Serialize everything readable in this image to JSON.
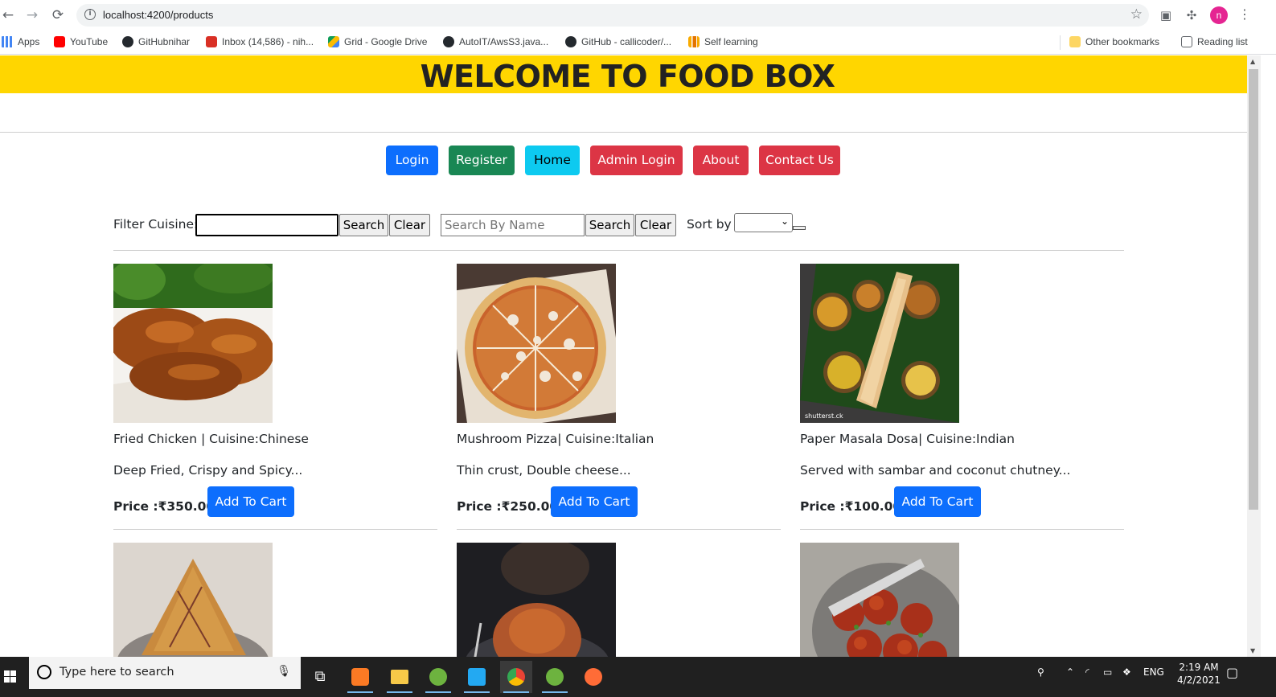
{
  "browser": {
    "url": "localhost:4200/products",
    "profile_initial": "n",
    "bookmarks": [
      {
        "label": "Apps",
        "color": "#4285f4"
      },
      {
        "label": "YouTube",
        "color": "#ff0000"
      },
      {
        "label": "GitHubnihar",
        "color": "#24292e"
      },
      {
        "label": "Inbox (14,586) - nih...",
        "color": "#d93025"
      },
      {
        "label": "Grid - Google Drive",
        "color": "#fbbc04"
      },
      {
        "label": "AutoIT/AwsS3.java...",
        "color": "#24292e"
      },
      {
        "label": "GitHub - callicoder/...",
        "color": "#24292e"
      },
      {
        "label": "Self learning",
        "color": "#fbbc04"
      }
    ],
    "other_bookmarks": "Other bookmarks",
    "reading_list": "Reading list"
  },
  "header": {
    "title": "WELCOME TO FOOD BOX",
    "banner_color": "#ffd600"
  },
  "nav": {
    "buttons": [
      {
        "label": "Login",
        "variant": "primary"
      },
      {
        "label": "Register",
        "variant": "success"
      },
      {
        "label": "Home",
        "variant": "info"
      },
      {
        "label": "Admin Login",
        "variant": "danger"
      },
      {
        "label": "About",
        "variant": "danger"
      },
      {
        "label": "Contact Us",
        "variant": "danger"
      }
    ]
  },
  "filters": {
    "cuisine_label": "Filter Cuisine:",
    "cuisine_value": "",
    "search_label": "Search",
    "clear_label": "Clear",
    "name_placeholder": "Search By Name",
    "sort_label": "Sort by",
    "sort_value": ""
  },
  "products": [
    {
      "title": "Fried Chicken | Cuisine:Chinese",
      "desc": "Deep Fried, Crispy and Spicy...",
      "price": "Price :₹350.00",
      "button": "Add To Cart"
    },
    {
      "title": "Mushroom Pizza| Cuisine:Italian",
      "desc": "Thin crust, Double cheese...",
      "price": "Price :₹250.00",
      "button": "Add To Cart"
    },
    {
      "title": "Paper Masala Dosa| Cuisine:Indian",
      "desc": "Served with sambar and coconut chutney...",
      "price": "Price :₹100.00",
      "button": "Add To Cart"
    }
  ],
  "taskbar": {
    "search_placeholder": "Type here to search",
    "lang": "ENG",
    "time": "2:19 AM",
    "date": "4/2/2021"
  },
  "colors": {
    "primary": "#0d6efd",
    "success": "#198754",
    "info": "#0dcaf0",
    "danger": "#dc3545"
  }
}
